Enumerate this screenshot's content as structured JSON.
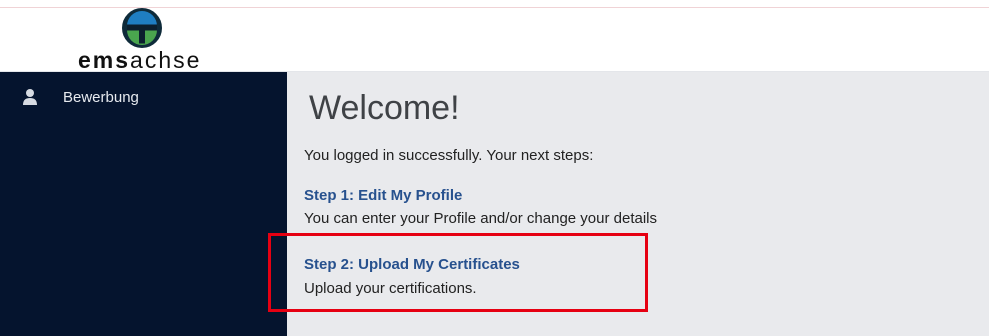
{
  "logo": {
    "text_bold": "ems",
    "text_light": "achse",
    "mark_icon": "emsachse-logo-icon",
    "colors": {
      "ring": "#0f2b3a",
      "top": "#1f7ec2",
      "bottom": "#4aa54e",
      "bar": "#0c1f2e"
    }
  },
  "sidebar": {
    "items": [
      {
        "label": "Bewerbung",
        "icon": "user-icon"
      }
    ]
  },
  "main": {
    "title": "Welcome!",
    "intro": "You logged in successfully. Your next steps:",
    "steps": [
      {
        "link": "Step 1: Edit My Profile",
        "description": "You can enter your Profile and/or change your details"
      },
      {
        "link": "Step 2: Upload My Certificates",
        "description": "Upload your certifications."
      }
    ]
  },
  "colors": {
    "sidebar_bg": "#05142e",
    "main_bg": "#e9eaed",
    "link": "#27518e",
    "highlight": "#e60012"
  }
}
